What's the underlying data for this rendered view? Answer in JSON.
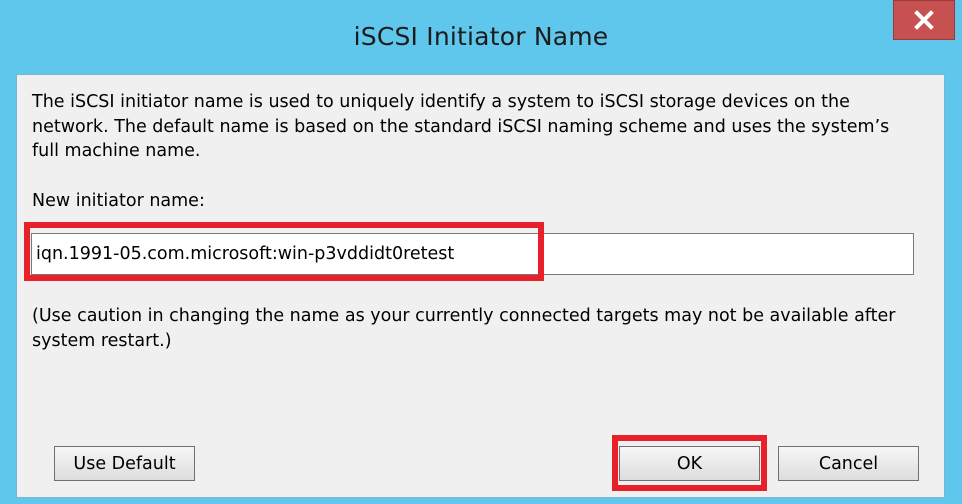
{
  "window": {
    "title": "iSCSI Initiator Name",
    "close_label": "x"
  },
  "dialog": {
    "description": "The iSCSI initiator name is used to uniquely identify a system to iSCSI storage devices on the network.  The default name is based on the standard iSCSI naming scheme and uses the system’s full machine name.",
    "field_label": "New initiator name:",
    "initiator_name_value": "iqn.1991-05.com.microsoft:win-p3vddidt0retest",
    "caution": "(Use caution in changing the name as your currently connected targets may not be available after system restart.)"
  },
  "buttons": {
    "use_default": "Use Default",
    "ok": "OK",
    "cancel": "Cancel"
  },
  "colors": {
    "title_bar": "#5fc6ec",
    "close_button": "#c75050",
    "dialog_background": "#f0f0f0",
    "highlight": "#e8202a"
  },
  "icons": {
    "close": "close-icon"
  }
}
